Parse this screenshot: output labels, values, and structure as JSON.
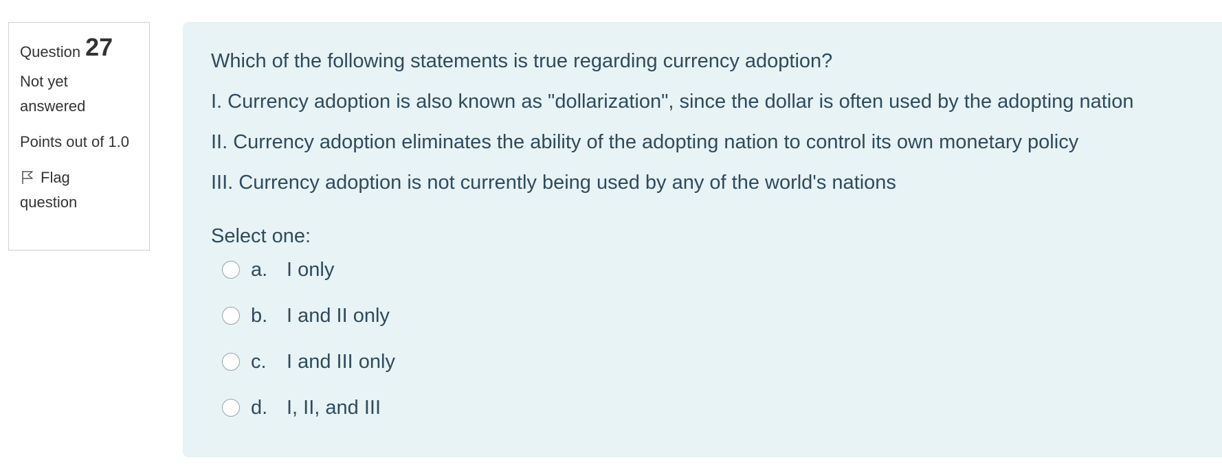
{
  "question_info": {
    "label": "Question",
    "number": "27",
    "state": "Not yet answered",
    "grade": "Points out of 1.0",
    "flag_label": "Flag question",
    "flag_icon": "flag-outline-icon"
  },
  "question": {
    "text": "Which of the following statements is true regarding currency adoption?",
    "statements": [
      "I. Currency adoption is also known as \"dollarization\", since the dollar is often used by the adopting nation",
      "II. Currency adoption eliminates the ability of the adopting nation to control its own monetary policy",
      "III. Currency adoption is not currently being used by any of the world's nations"
    ],
    "prompt": "Select one:",
    "options": [
      {
        "letter": "a.",
        "text": "I only"
      },
      {
        "letter": "b.",
        "text": "I and II only"
      },
      {
        "letter": "c.",
        "text": "I and III only"
      },
      {
        "letter": "d.",
        "text": "I, II, and III"
      }
    ]
  },
  "colors": {
    "panel_background": "#e7f3f5",
    "question_text": "#2f4a5d",
    "info_border": "#cfcfcf"
  }
}
